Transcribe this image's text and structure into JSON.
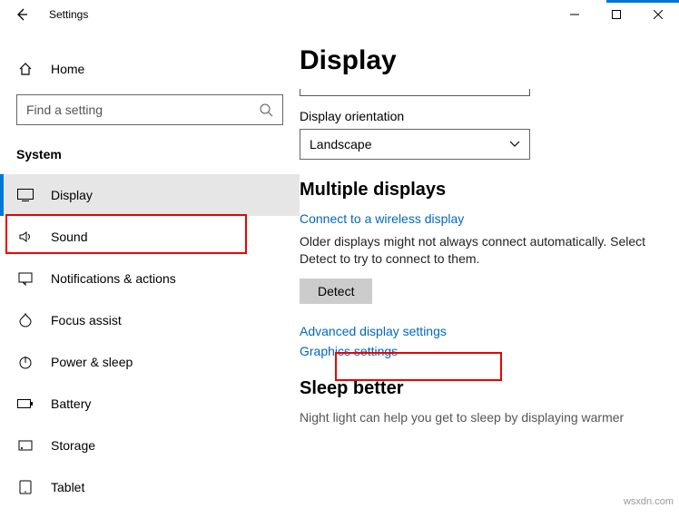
{
  "window": {
    "title": "Settings"
  },
  "sidebar": {
    "home_label": "Home",
    "search_placeholder": "Find a setting",
    "heading": "System",
    "items": [
      {
        "label": "Display"
      },
      {
        "label": "Sound"
      },
      {
        "label": "Notifications & actions"
      },
      {
        "label": "Focus assist"
      },
      {
        "label": "Power & sleep"
      },
      {
        "label": "Battery"
      },
      {
        "label": "Storage"
      },
      {
        "label": "Tablet"
      }
    ]
  },
  "main": {
    "title": "Display",
    "orientation_label": "Display orientation",
    "orientation_value": "Landscape",
    "multiple_heading": "Multiple displays",
    "connect_link": "Connect to a wireless display",
    "detect_hint": "Older displays might not always connect automatically. Select Detect to try to connect to them.",
    "detect_button": "Detect",
    "advanced_link": "Advanced display settings",
    "graphics_link": "Graphics settings",
    "sleep_heading": "Sleep better",
    "sleep_text": "Night light can help you get to sleep by displaying warmer"
  },
  "watermark": "wsxdn.com"
}
